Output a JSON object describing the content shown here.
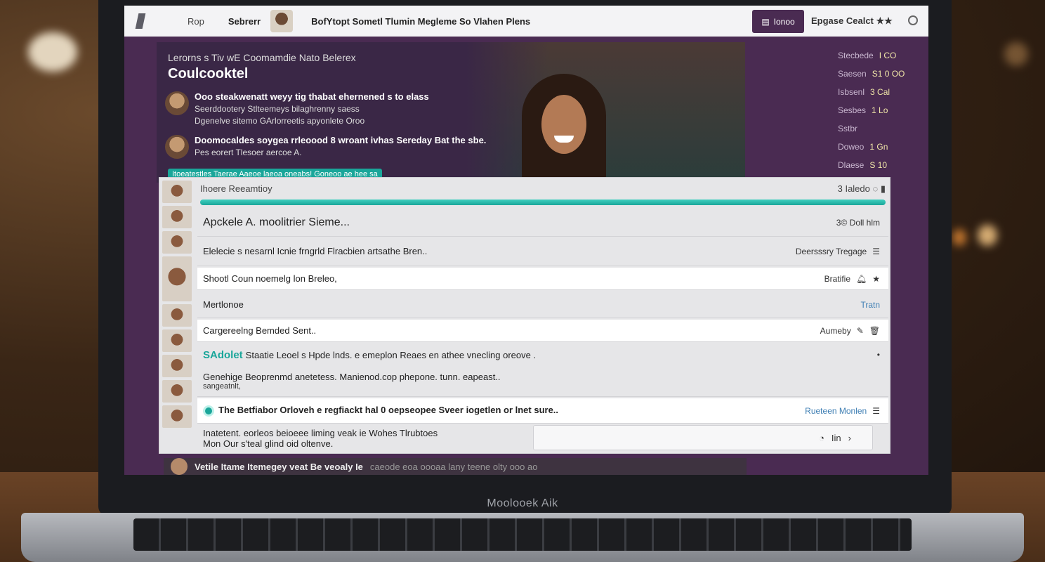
{
  "window": {
    "topbar": {
      "nav_1": "Rop",
      "nav_2": "Sebrerr",
      "title": "BofYtopt Sometl Tlumin Megleme So Vlahen Plens",
      "button": "Ionoo",
      "right_text": "Epgase Cealct ★★"
    }
  },
  "hero": {
    "kicker": "Lerorns s Tiv wE Coomamdie Nato Belerex",
    "title": "Coulcooktel",
    "items": [
      {
        "title": "Ooo steakwenatt weyy tig thabat ehernened s to elass",
        "line1": "Seerddootery Stlteemeys bilaghrenny saess",
        "line2": "Dgenelve sitemo GArlorreetis apyonlete Oroo"
      },
      {
        "title": "Doomocaldes soygea rrleoood 8 wroant ivhas Sereday Bat the sbe.",
        "line1": "Pes eorert Tlesoer aercoe A."
      }
    ],
    "tags": "Itoeatestles Taerae Aaeoe laeoa oneabs! Goneoo ae hee sa"
  },
  "sidebar": [
    {
      "label": "Stecbede",
      "value": "I CO"
    },
    {
      "label": "Saesen",
      "value": "S1 0 OO"
    },
    {
      "label": "Isbsenl",
      "value": "3 Cal"
    },
    {
      "label": "Sesbes",
      "value": "1 Lo"
    },
    {
      "label": "Sstbr",
      "value": ""
    },
    {
      "label": "Doweo",
      "value": "1 Gn"
    },
    {
      "label": "Dlaese",
      "value": "S 10"
    }
  ],
  "panel": {
    "header_left": "Ihoere Reeamtioy",
    "header_right": "3 Ialedo",
    "progress": 1.0,
    "rows": [
      {
        "text": "Apckele A. moolitrier Sieme...",
        "right": "3© Doll hlm"
      },
      {
        "text": "Elelecie s nesarnl Icnie frngrld Flracbien artsathe Bren..",
        "right": "Deersssry Tregage"
      },
      {
        "text": "Shootl Coun noemelg lon Breleo,",
        "right": "Bratifie"
      },
      {
        "text": "Mertlonoe",
        "right": "Tratn"
      },
      {
        "text": "Cargereelng Bemded Sent..",
        "right": "Aumeby"
      },
      {
        "prefix": "SAdolet",
        "text": "Staatie Leoel s Hpde lnds. e emeplon Reaes en athee vnecling oreove ."
      },
      {
        "text": "Genehige Beoprenmd anetetess. Manienod.cop phepone. tunn. eapeast..",
        "text2": "sangeatnlt,"
      },
      {
        "text": "The Betfiabor Orloveh e regfiackt hal 0 oepseopee Sveer iogetlen or lnet sure..",
        "right": "Rueteen Monlen"
      }
    ],
    "last_row": {
      "line1": "Inatetent. eorleos beioeee liming veak ie Wohes Tlrubtoes",
      "line2": "Mon Our s'teal glind oid oltenve."
    },
    "reply_button": "Iin"
  },
  "bottom_strip": {
    "bold": "Vetile Itame Itemegey veat  Be veoaly Ie",
    "muted": "caeode eoa oooaa lany teene olty ooo ao"
  },
  "brand": "Moolooek Aik"
}
